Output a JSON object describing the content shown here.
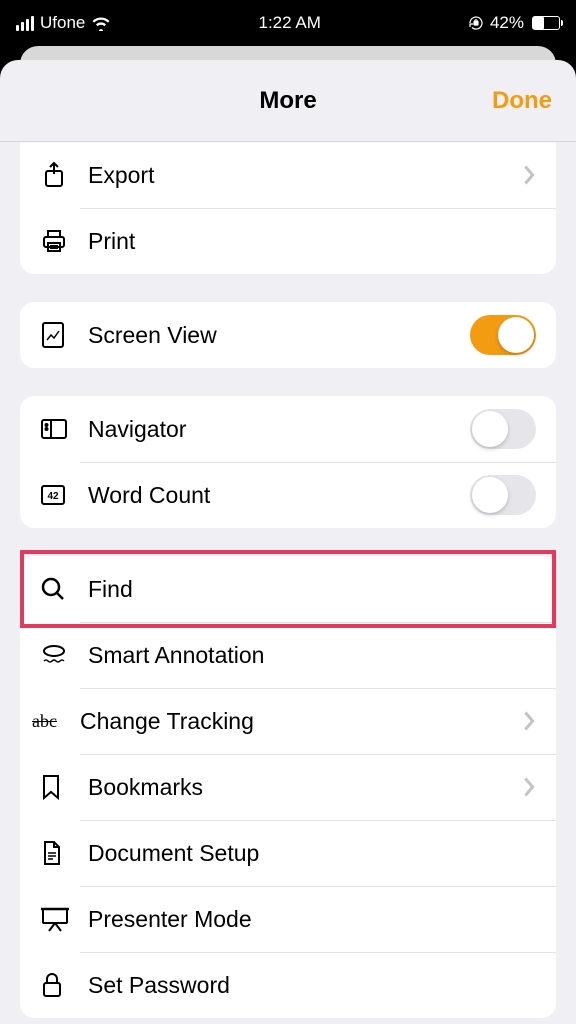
{
  "status": {
    "carrier": "Ufone",
    "time": "1:22 AM",
    "battery_pct": "42%"
  },
  "header": {
    "title": "More",
    "done": "Done"
  },
  "group1": {
    "export": "Export",
    "print": "Print"
  },
  "group2": {
    "screen_view": "Screen View",
    "screen_view_on": true
  },
  "group3": {
    "navigator": "Navigator",
    "navigator_on": false,
    "word_count": "Word Count",
    "word_count_on": false
  },
  "group4": {
    "find": "Find",
    "smart_annotation": "Smart Annotation",
    "change_tracking": "Change Tracking",
    "bookmarks": "Bookmarks",
    "document_setup": "Document Setup",
    "presenter_mode": "Presenter Mode",
    "set_password": "Set Password"
  },
  "highlight_row": "find"
}
